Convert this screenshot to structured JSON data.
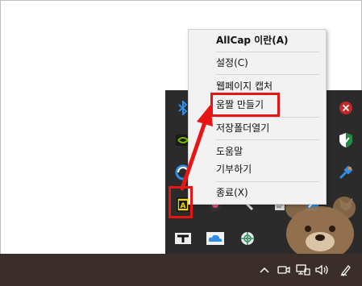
{
  "context_menu": {
    "items": [
      {
        "label": "AllCap 이란(A)"
      },
      {
        "label": "설정(C)"
      },
      {
        "label": "웹페이지 캡처"
      },
      {
        "label": "움짤 만들기"
      },
      {
        "label": "저장폴더열기"
      },
      {
        "label": "도움말"
      },
      {
        "label": "기부하기"
      },
      {
        "label": "종료(X)"
      }
    ]
  },
  "tray_icons": [
    "bluetooth-icon",
    "nvidia-icon",
    "sync-icon",
    "allcap-tray-icon",
    "black-app-icon",
    "onedrive-icon",
    "network-globe-icon",
    "close-red-icon",
    "shield-icon",
    "satellite-icon",
    "wolf-icon",
    "blue-arrow-icon",
    "bear-icon"
  ],
  "taskbar_icons": [
    "chevron-up-icon",
    "meet-now-icon",
    "network-icon",
    "volume-icon",
    "pen-icon"
  ],
  "colors": {
    "highlight": "#e81515",
    "menu_bg": "#f2f2f2",
    "flyout_bg": "#2b2b2b",
    "taskbar_bg": "#3b2e2a"
  }
}
